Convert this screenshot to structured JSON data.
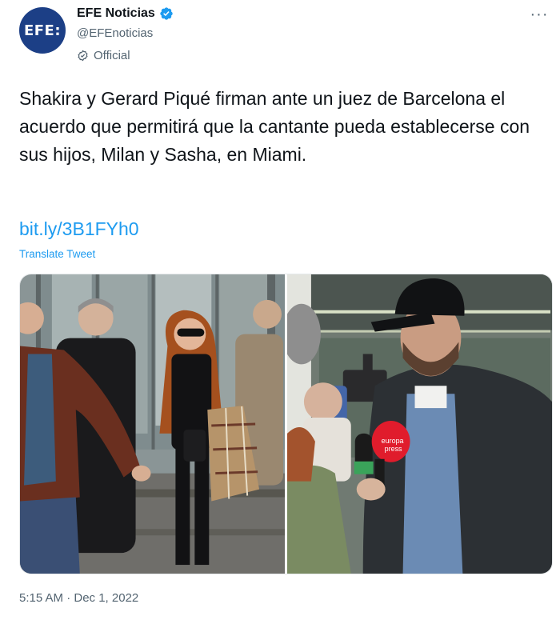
{
  "account": {
    "avatar_text": "EFE:",
    "display_name": "EFE Noticias",
    "handle": "@EFEnoticias",
    "label": "Official",
    "verified_icon": "verified-badge-icon",
    "brand_color": "#1c3f86",
    "verified_color": "#1d9bf0"
  },
  "more_menu": "···",
  "tweet": {
    "text": "Shakira y Gerard Piqué firman ante un juez de Barcelona el acuerdo que permitirá que la cantante pueda establecerse con sus hijos, Milan y Sasha, en Miami.",
    "link": "bit.ly/3B1FYh0",
    "translate": "Translate Tweet",
    "timestamp": "5:15 AM · Dec 1, 2022"
  },
  "media": {
    "microphone_text_line1": "europa",
    "microphone_text_line2": "press"
  },
  "colors": {
    "link": "#1d9bf0",
    "secondary_text": "#536471",
    "primary_text": "#0f1419"
  }
}
